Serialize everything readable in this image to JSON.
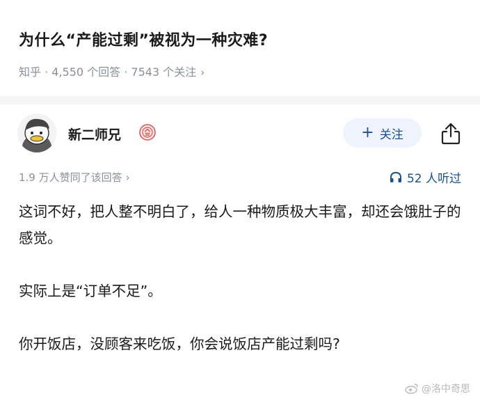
{
  "question": {
    "title": "为什么“产能过剩”被视为一种灾难?",
    "meta": "知乎 · 4,550 个回答 · 7543 个关注",
    "meta_chevron": "›"
  },
  "author": {
    "name": "新二师兄",
    "follow_label": "关注",
    "follow_icon": "plus-icon"
  },
  "stats": {
    "likes": "1.9 万人赞同了该回答",
    "likes_chevron": "›",
    "listen": "52 人听过"
  },
  "answer": {
    "paragraphs": [
      "这词不好，把人整不明白了，给人一种物质极大丰富，却还会饿肚子的感觉。",
      "实际上是“订单不足”。",
      "你开饭店，没顾客来吃饭，你会说饭店产能过剩吗?"
    ]
  },
  "watermark": {
    "text": "@洛中奇思"
  },
  "colors": {
    "accent": "#175199",
    "follow_bg": "#eef3fd",
    "meta_gray": "#8a8f99",
    "band": "#f6f6f6"
  }
}
